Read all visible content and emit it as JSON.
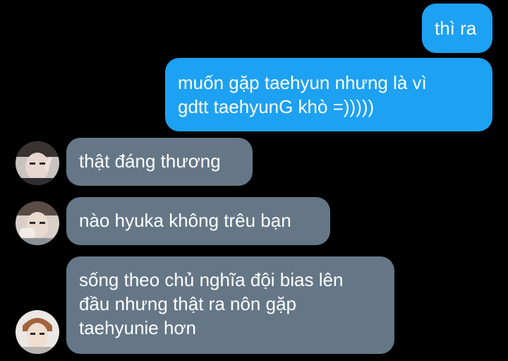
{
  "messages": [
    {
      "direction": "out",
      "text": "thì ra"
    },
    {
      "direction": "out",
      "text": "muốn gặp taehyun nhưng là vì\ngdtt taehyunG khò =)))))"
    },
    {
      "direction": "in",
      "text": "thật đáng thương",
      "avatar": "user-avatar-1"
    },
    {
      "direction": "in",
      "text": "nào hyuka không trêu bạn",
      "avatar": "user-avatar-2"
    },
    {
      "direction": "in",
      "text": "sống theo chủ nghĩa đội bias lên\nđầu nhưng thật ra nôn gặp\ntaehyunie hơn",
      "avatar": "user-avatar-3"
    }
  ],
  "colors": {
    "background": "#000000",
    "outgoing_bubble": "#1da1f2",
    "incoming_bubble": "#657786",
    "text": "#ffffff"
  }
}
